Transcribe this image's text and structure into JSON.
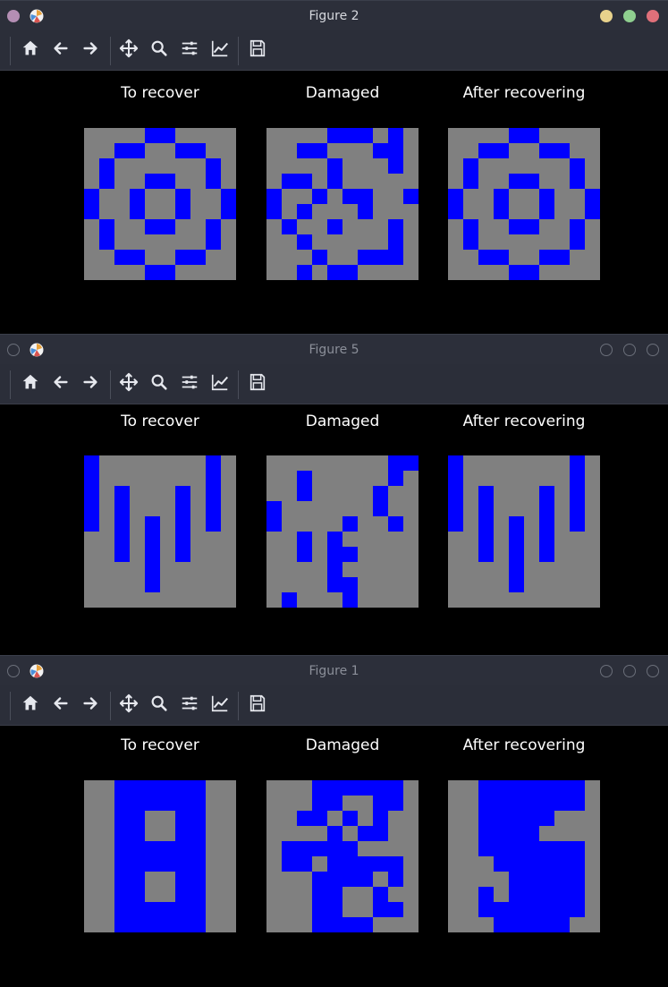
{
  "windows": [
    {
      "title": "Figure 2",
      "active": true,
      "panels": [
        {
          "label": "To recover",
          "cols": 10,
          "grid": [
            "0000110000",
            "0011001100",
            "0100000010",
            "0100110010",
            "1001001001",
            "1001001001",
            "0100110010",
            "0100000010",
            "0011001100",
            "0000110000"
          ]
        },
        {
          "label": "Damaged",
          "cols": 10,
          "grid": [
            "0000111010",
            "0011000110",
            "0000100010",
            "0110100000",
            "1001011001",
            "1010001000",
            "0100100010",
            "0010000010",
            "0001001110",
            "0010110000"
          ]
        },
        {
          "label": "After recovering",
          "cols": 10,
          "grid": [
            "0000110000",
            "0011001100",
            "0100000010",
            "0100110010",
            "1001001001",
            "1001001001",
            "0100110010",
            "0100000010",
            "0011001100",
            "0000110000"
          ]
        }
      ]
    },
    {
      "title": "Figure 5",
      "active": false,
      "panels": [
        {
          "label": "To recover",
          "cols": 10,
          "grid": [
            "1000000010",
            "1000000010",
            "1010001010",
            "1010001010",
            "1010101010",
            "0010101000",
            "0010101000",
            "0000100000",
            "0000100000",
            "0000000000"
          ]
        },
        {
          "label": "Damaged",
          "cols": 10,
          "grid": [
            "0000000011",
            "0010000010",
            "0010000100",
            "1000000100",
            "1000010010",
            "0010100000",
            "0010110000",
            "0000100000",
            "0000110000",
            "0100010000"
          ]
        },
        {
          "label": "After recovering",
          "cols": 10,
          "grid": [
            "1000000010",
            "1000000010",
            "1010001010",
            "1010001010",
            "1010101010",
            "0010101000",
            "0010101000",
            "0000100000",
            "0000100000",
            "0000000000"
          ]
        }
      ]
    },
    {
      "title": "Figure 1",
      "active": false,
      "panels": [
        {
          "label": "To recover",
          "cols": 10,
          "grid": [
            "0011111100",
            "0011111100",
            "0011001100",
            "0011001100",
            "0011111100",
            "0011111100",
            "0011001100",
            "0011001100",
            "0011111100",
            "0011111100"
          ]
        },
        {
          "label": "Damaged",
          "cols": 10,
          "grid": [
            "0001111110",
            "0001100110",
            "0011010100",
            "0000101100",
            "0111110000",
            "0110111110",
            "0001111010",
            "0001100100",
            "0001100110",
            "0001111000"
          ]
        },
        {
          "label": "After recovering",
          "cols": 10,
          "grid": [
            "0011111110",
            "0011111110",
            "0011111000",
            "0011110000",
            "0011111110",
            "0001111110",
            "0000111110",
            "0010111110",
            "0011111110",
            "0001111100"
          ]
        }
      ]
    }
  ],
  "toolbar_buttons": [
    {
      "name": "home-icon",
      "label": "Home"
    },
    {
      "name": "back-arrow-icon",
      "label": "Back"
    },
    {
      "name": "forward-arrow-icon",
      "label": "Forward"
    },
    {
      "name": "pan-move-icon",
      "label": "Pan"
    },
    {
      "name": "zoom-magnifier-icon",
      "label": "Zoom"
    },
    {
      "name": "configure-subplots-icon",
      "label": "Subplots"
    },
    {
      "name": "edit-axis-icon",
      "label": "Customize"
    },
    {
      "name": "save-floppy-icon",
      "label": "Save"
    }
  ],
  "colors": {
    "filled": "#0000ff",
    "empty": "#808080",
    "background": "#000000",
    "titlebar": "#2c2f3a",
    "toolbar": "#2b2e39",
    "dot_close": "#e0707a",
    "dot_max": "#8fcf8f",
    "dot_min": "#e8d28c",
    "dot_menu": "#b48eb4"
  }
}
